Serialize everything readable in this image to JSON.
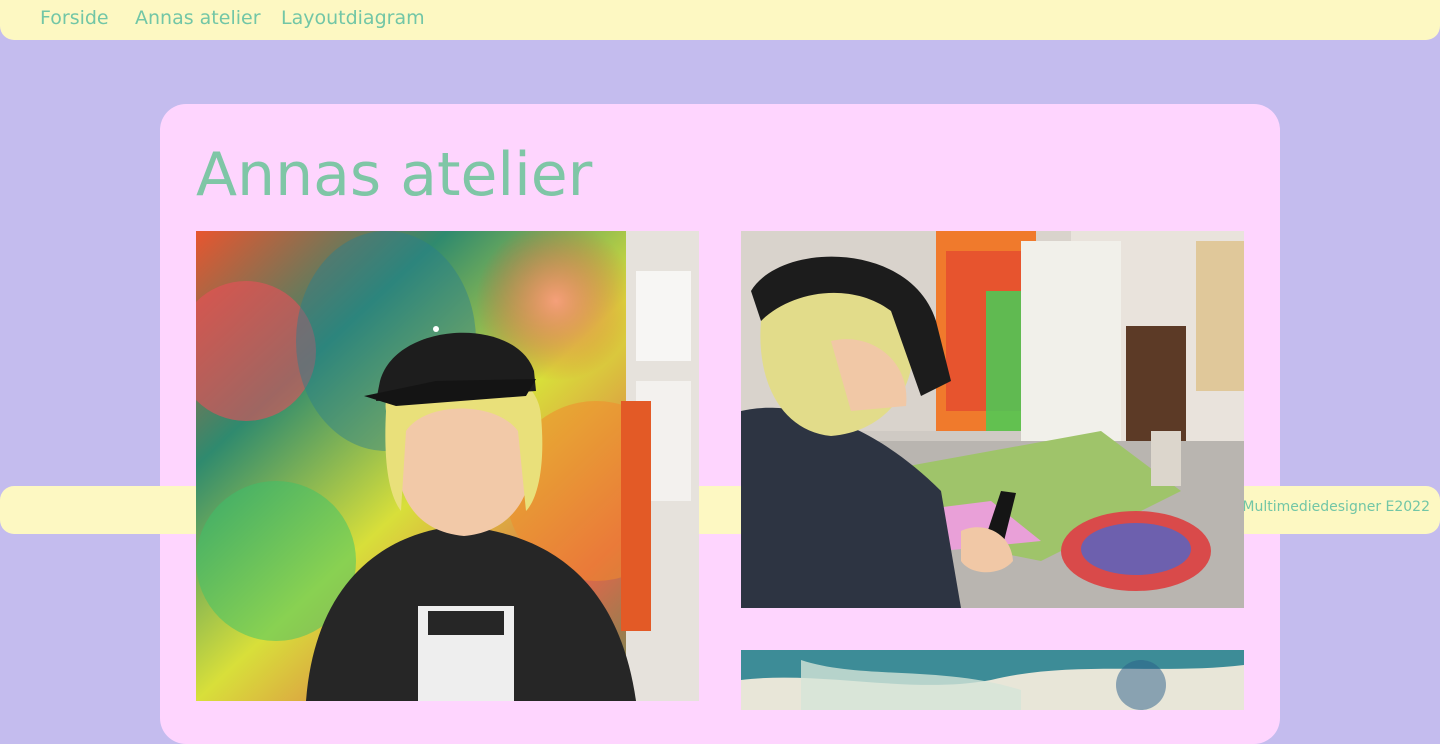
{
  "nav": {
    "items": [
      {
        "label": "Forside"
      },
      {
        "label": "Annas atelier"
      },
      {
        "label": "Layoutdiagram"
      }
    ]
  },
  "page": {
    "title": "Annas atelier"
  },
  "footer": {
    "text": "Laura Maage Multimediedesigner E2022"
  },
  "colors": {
    "background": "#c4bcee",
    "nav_bg": "#fdf8c2",
    "card_bg": "#fed5fe",
    "accent_green": "#72c6a6"
  },
  "images": [
    {
      "name": "anna-portrait-photo",
      "description": "portrait in front of painting"
    },
    {
      "name": "anna-painting-photo",
      "description": "painting at studio table"
    },
    {
      "name": "painting-detail-photo",
      "description": "painting detail"
    }
  ]
}
